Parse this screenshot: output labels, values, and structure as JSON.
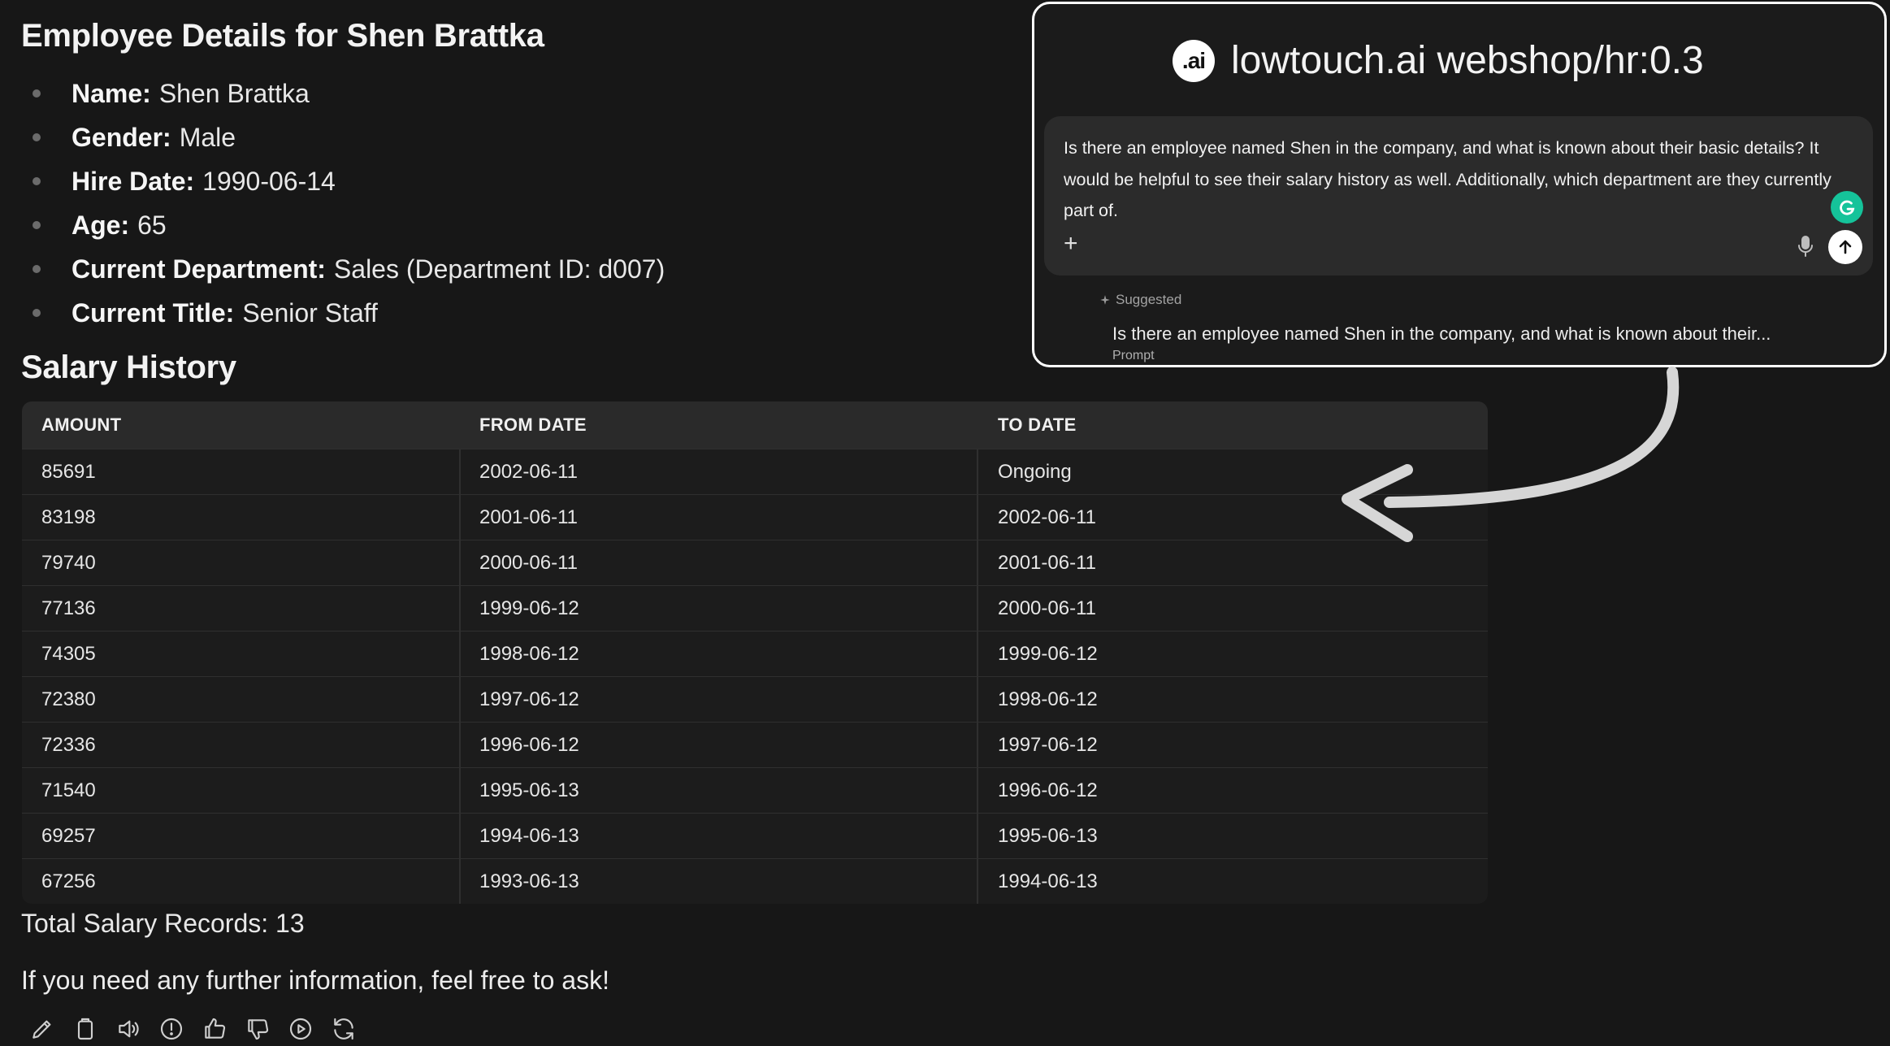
{
  "details": {
    "heading": "Employee Details for Shen Brattka",
    "items": [
      {
        "label": "Name:",
        "value": "Shen Brattka"
      },
      {
        "label": "Gender:",
        "value": "Male"
      },
      {
        "label": "Hire Date:",
        "value": "1990-06-14"
      },
      {
        "label": "Age:",
        "value": "65"
      },
      {
        "label": "Current Department:",
        "value": "Sales (Department ID: d007)"
      },
      {
        "label": "Current Title:",
        "value": "Senior Staff"
      }
    ]
  },
  "salary": {
    "heading": "Salary History",
    "columns": [
      "AMOUNT",
      "FROM DATE",
      "TO DATE"
    ],
    "rows": [
      [
        "85691",
        "2002-06-11",
        "Ongoing"
      ],
      [
        "83198",
        "2001-06-11",
        "2002-06-11"
      ],
      [
        "79740",
        "2000-06-11",
        "2001-06-11"
      ],
      [
        "77136",
        "1999-06-12",
        "2000-06-11"
      ],
      [
        "74305",
        "1998-06-12",
        "1999-06-12"
      ],
      [
        "72380",
        "1997-06-12",
        "1998-06-12"
      ],
      [
        "72336",
        "1996-06-12",
        "1997-06-12"
      ],
      [
        "71540",
        "1995-06-13",
        "1996-06-12"
      ],
      [
        "69257",
        "1994-06-13",
        "1995-06-13"
      ],
      [
        "67256",
        "1993-06-13",
        "1994-06-13"
      ]
    ],
    "total": "Total Salary Records: 13",
    "closing": "If you need any further information, feel free to ask!"
  },
  "actions": [
    "edit-icon",
    "copy-icon",
    "speaker-icon",
    "info-icon",
    "thumbs-up-icon",
    "thumbs-down-icon",
    "play-icon",
    "regenerate-icon"
  ],
  "popup": {
    "logo": ".ai",
    "title": "lowtouch.ai webshop/hr:0.3",
    "prompt": "Is there an employee named Shen in the company, and what is known about their basic details? It would be helpful to see their salary history as well. Additionally, which department are they currently part of.",
    "plus": "+",
    "suggested_label": "Suggested",
    "suggested_text": "Is there an employee named Shen in the company, and what is known about their...",
    "suggested_sub": "Prompt"
  },
  "colors": {
    "background": "#171717",
    "table_header": "#2a2a2a",
    "grammarly": "#15c39a"
  }
}
